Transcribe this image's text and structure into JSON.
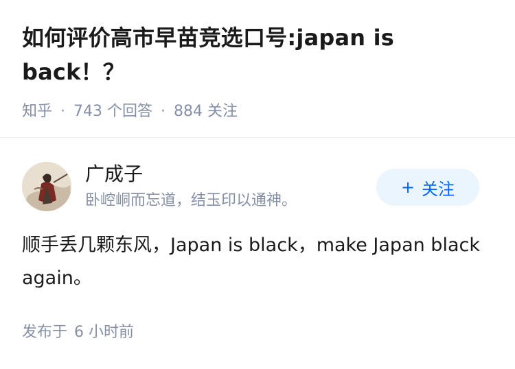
{
  "question": {
    "title": "如何评价高市早苗竞选口号:japan is back！？",
    "source": "知乎",
    "answers_count": "743",
    "answers_label": "个回答",
    "followers_count": "884",
    "followers_label": "关注"
  },
  "answer": {
    "author_name": "广成子",
    "author_bio": "卧崆峒而忘道，结玉印以通神。",
    "follow_button_label": "关注",
    "content": "顺手丢几颗东风，Japan is black，make Japan black again。",
    "published_label": "发布于",
    "published_time": "6 小时前"
  },
  "colors": {
    "accent": "#0066ff",
    "follow_bg": "#ebf5fd",
    "meta_gray": "#8590a6"
  }
}
